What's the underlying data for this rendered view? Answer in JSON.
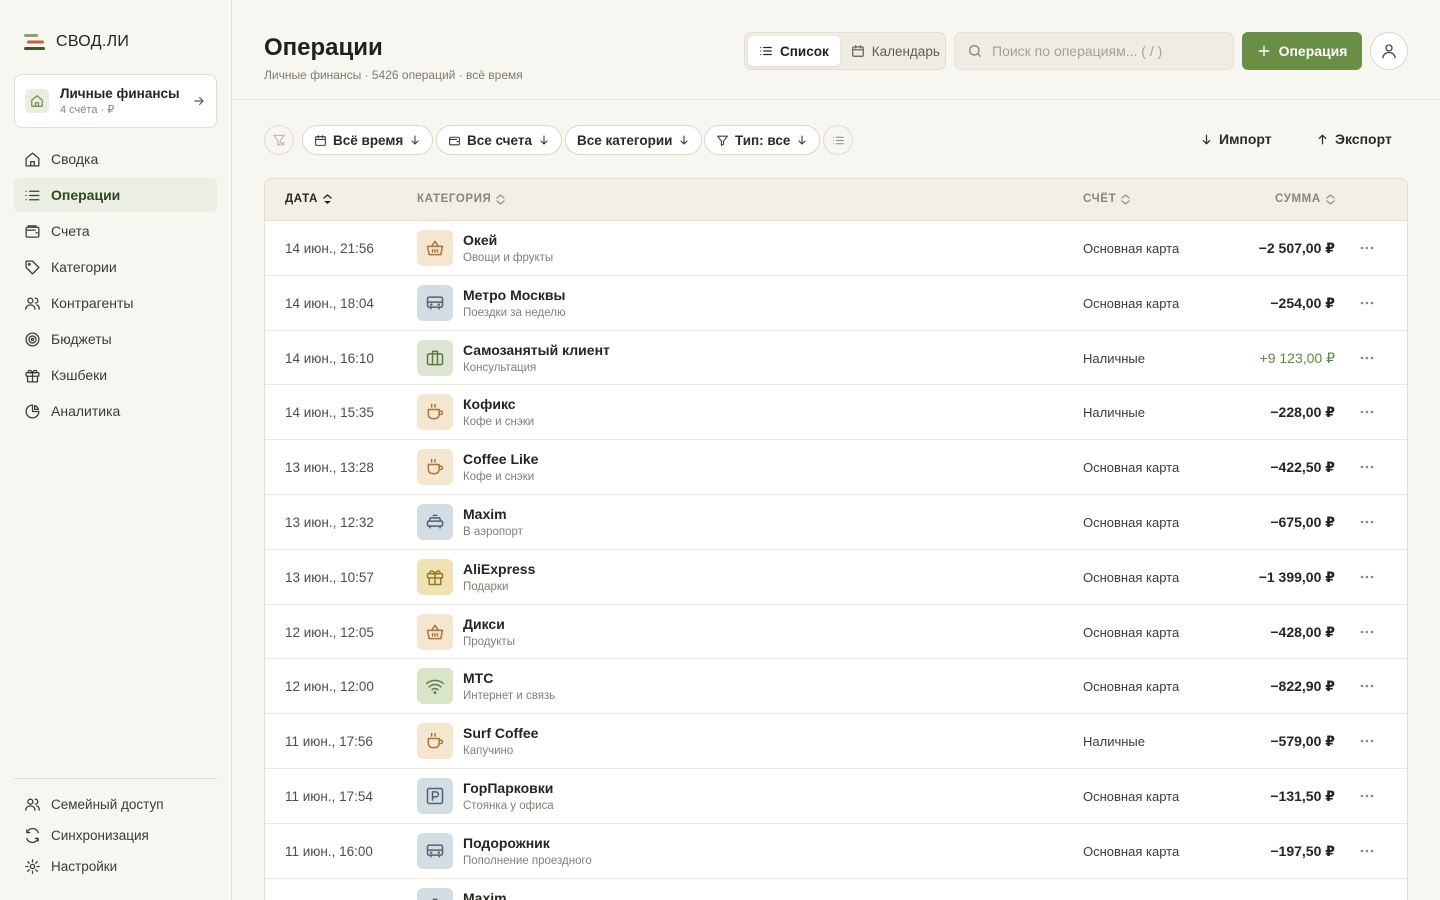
{
  "app": {
    "logo_text": "СВОД.ЛИ"
  },
  "workspace": {
    "name": "Личные финансы",
    "sub": "4 счёта · ₽"
  },
  "nav": [
    {
      "label": "Сводка",
      "icon": "home-icon"
    },
    {
      "label": "Операции",
      "icon": "list-icon",
      "active": true
    },
    {
      "label": "Счета",
      "icon": "wallet-icon"
    },
    {
      "label": "Категории",
      "icon": "tag-icon"
    },
    {
      "label": "Контрагенты",
      "icon": "users-icon"
    },
    {
      "label": "Бюджеты",
      "icon": "target-icon"
    },
    {
      "label": "Кэшбеки",
      "icon": "gift-icon"
    },
    {
      "label": "Аналитика",
      "icon": "pie-icon"
    }
  ],
  "bottom_nav": [
    {
      "label": "Семейный доступ",
      "icon": "users-icon"
    },
    {
      "label": "Синхронизация",
      "icon": "sync-icon"
    },
    {
      "label": "Настройки",
      "icon": "gear-icon"
    }
  ],
  "header": {
    "title": "Операции",
    "subtitle": "Личные финансы · 5426 операций · всё время",
    "view_list": "Список",
    "view_calendar": "Календарь",
    "search_placeholder": "Поиск по операциям... ( / )",
    "add_label": "Операция"
  },
  "filters": {
    "period": "Всё время",
    "accounts": "Все счета",
    "categories": "Все категории",
    "type": "Тип: все",
    "import": "Импорт",
    "export": "Экспорт"
  },
  "table": {
    "columns": {
      "date": "ДАТА",
      "category": "КАТЕГОРИЯ",
      "account": "СЧЁТ",
      "amount": "СУММА"
    },
    "rows": [
      {
        "date": "14 июн., 21:56",
        "name": "Окей",
        "sub": "Овощи и фрукты",
        "account": "Основная карта",
        "amount": "−2 507,00 ₽",
        "icon": "basket-icon",
        "tone": "#f5e6cf",
        "ink": "#a8763a"
      },
      {
        "date": "14 июн., 18:04",
        "name": "Метро Москвы",
        "sub": "Поездки за неделю",
        "account": "Основная карта",
        "amount": "−254,00 ₽",
        "icon": "bus-icon",
        "tone": "#d3dde3",
        "ink": "#4e6474"
      },
      {
        "date": "14 июн., 16:10",
        "name": "Самозанятый клиент",
        "sub": "Консультация",
        "account": "Наличные",
        "amount": "+9 123,00 ₽",
        "positive": true,
        "icon": "briefcase-icon",
        "tone": "#dde6d3",
        "ink": "#5d7a44"
      },
      {
        "date": "14 июн., 15:35",
        "name": "Кофикс",
        "sub": "Кофе и снэки",
        "account": "Наличные",
        "amount": "−228,00 ₽",
        "icon": "coffee-icon",
        "tone": "#f5e6cf",
        "ink": "#a8763a"
      },
      {
        "date": "13 июн., 13:28",
        "name": "Coffee Like",
        "sub": "Кофе и снэки",
        "account": "Основная карта",
        "amount": "−422,50 ₽",
        "icon": "coffee-icon",
        "tone": "#f5e6cf",
        "ink": "#a8763a"
      },
      {
        "date": "13 июн., 12:32",
        "name": "Maxim",
        "sub": "В аэропорт",
        "account": "Основная карта",
        "amount": "−675,00 ₽",
        "icon": "taxi-icon",
        "tone": "#d3dde3",
        "ink": "#4e6474"
      },
      {
        "date": "13 июн., 10:57",
        "name": "AliExpress",
        "sub": "Подарки",
        "account": "Основная карта",
        "amount": "−1 399,00 ₽",
        "icon": "gift-icon",
        "tone": "#efe2b5",
        "ink": "#9a7a22"
      },
      {
        "date": "12 июн., 12:05",
        "name": "Дикси",
        "sub": "Продукты",
        "account": "Основная карта",
        "amount": "−428,00 ₽",
        "icon": "basket-icon",
        "tone": "#f5e6cf",
        "ink": "#a8763a"
      },
      {
        "date": "12 июн., 12:00",
        "name": "МТС",
        "sub": "Интернет и связь",
        "account": "Основная карта",
        "amount": "−822,90 ₽",
        "icon": "wifi-icon",
        "tone": "#d9e4c9",
        "ink": "#5d7a44"
      },
      {
        "date": "11 июн., 17:56",
        "name": "Surf Coffee",
        "sub": "Капучино",
        "account": "Наличные",
        "amount": "−579,00 ₽",
        "icon": "coffee-icon",
        "tone": "#f5e6cf",
        "ink": "#a8763a"
      },
      {
        "date": "11 июн., 17:54",
        "name": "ГорПарковки",
        "sub": "Стоянка у офиса",
        "account": "Основная карта",
        "amount": "−131,50 ₽",
        "icon": "parking-icon",
        "tone": "#d3dde3",
        "ink": "#4e6474"
      },
      {
        "date": "11 июн., 16:00",
        "name": "Подорожник",
        "sub": "Пополнение проездного",
        "account": "Основная карта",
        "amount": "−197,50 ₽",
        "icon": "bus-icon",
        "tone": "#d3dde3",
        "ink": "#4e6474"
      },
      {
        "date": "",
        "name": "Maxim",
        "sub": "",
        "account": "",
        "amount": "",
        "icon": "taxi-icon",
        "tone": "#d3dde3",
        "ink": "#4e6474"
      }
    ]
  }
}
